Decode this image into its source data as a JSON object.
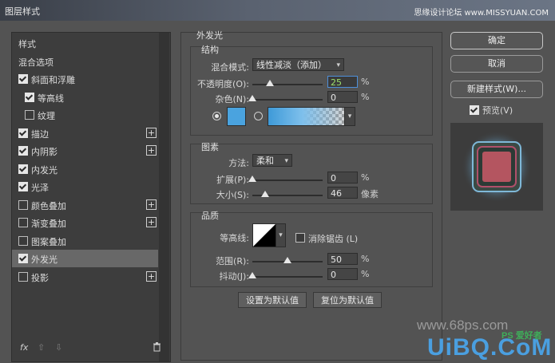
{
  "window": {
    "title": "图层样式",
    "watermark": "思缘设计论坛 www.MISSYUAN.COM"
  },
  "styles_list": {
    "items": [
      {
        "label": "样式",
        "checkbox": false,
        "checked": false,
        "plus": false,
        "indent": 0
      },
      {
        "label": "混合选项",
        "checkbox": false,
        "checked": false,
        "plus": false,
        "indent": 0
      },
      {
        "label": "斜面和浮雕",
        "checkbox": true,
        "checked": true,
        "plus": false,
        "indent": 0
      },
      {
        "label": "等高线",
        "checkbox": true,
        "checked": true,
        "plus": false,
        "indent": 1
      },
      {
        "label": "纹理",
        "checkbox": true,
        "checked": false,
        "plus": false,
        "indent": 1
      },
      {
        "label": "描边",
        "checkbox": true,
        "checked": true,
        "plus": true,
        "indent": 0
      },
      {
        "label": "内阴影",
        "checkbox": true,
        "checked": true,
        "plus": true,
        "indent": 0
      },
      {
        "label": "内发光",
        "checkbox": true,
        "checked": true,
        "plus": false,
        "indent": 0
      },
      {
        "label": "光泽",
        "checkbox": true,
        "checked": true,
        "plus": false,
        "indent": 0
      },
      {
        "label": "颜色叠加",
        "checkbox": true,
        "checked": false,
        "plus": true,
        "indent": 0
      },
      {
        "label": "渐变叠加",
        "checkbox": true,
        "checked": false,
        "plus": true,
        "indent": 0
      },
      {
        "label": "图案叠加",
        "checkbox": true,
        "checked": false,
        "plus": false,
        "indent": 0
      },
      {
        "label": "外发光",
        "checkbox": true,
        "checked": true,
        "plus": false,
        "indent": 0,
        "selected": true
      },
      {
        "label": "投影",
        "checkbox": true,
        "checked": false,
        "plus": true,
        "indent": 0
      }
    ],
    "footer": {
      "fx": "fx",
      "up": "⇧",
      "down": "⇩",
      "trash": "🗑"
    }
  },
  "outer_glow": {
    "section_title": "外发光",
    "structure": {
      "title": "结构",
      "blend_mode_label": "混合模式:",
      "blend_mode_value": "线性减淡（添加）",
      "opacity_label": "不透明度(O):",
      "opacity_value": "25",
      "opacity_fraction": 0.25,
      "noise_label": "杂色(N):",
      "noise_value": "0",
      "noise_fraction": 0.0,
      "percent": "%",
      "color": "#4aa3df"
    },
    "elements": {
      "title": "图素",
      "technique_label": "方法:",
      "technique_value": "柔和",
      "spread_label": "扩展(P):",
      "spread_value": "0",
      "spread_fraction": 0.0,
      "size_label": "大小(S):",
      "size_value": "46",
      "size_fraction": 0.18,
      "percent": "%",
      "px_unit": "像素"
    },
    "quality": {
      "title": "品质",
      "contour_label": "等高线:",
      "antialias_label": "消除锯齿 (L)",
      "range_label": "范围(R):",
      "range_value": "50",
      "range_fraction": 0.5,
      "jitter_label": "抖动(J):",
      "jitter_value": "0",
      "jitter_fraction": 0.0,
      "percent": "%"
    },
    "make_default": "设置为默认值",
    "reset_default": "复位为默认值"
  },
  "actions": {
    "ok": "确定",
    "cancel": "取消",
    "new_style": "新建样式(W)...",
    "preview_label": "预览(V)",
    "preview_checked": true
  },
  "watermarks": {
    "site1": "www.68ps.com",
    "site2": "UiBQ.CoM",
    "ps_badge": "PS 爱好者"
  }
}
